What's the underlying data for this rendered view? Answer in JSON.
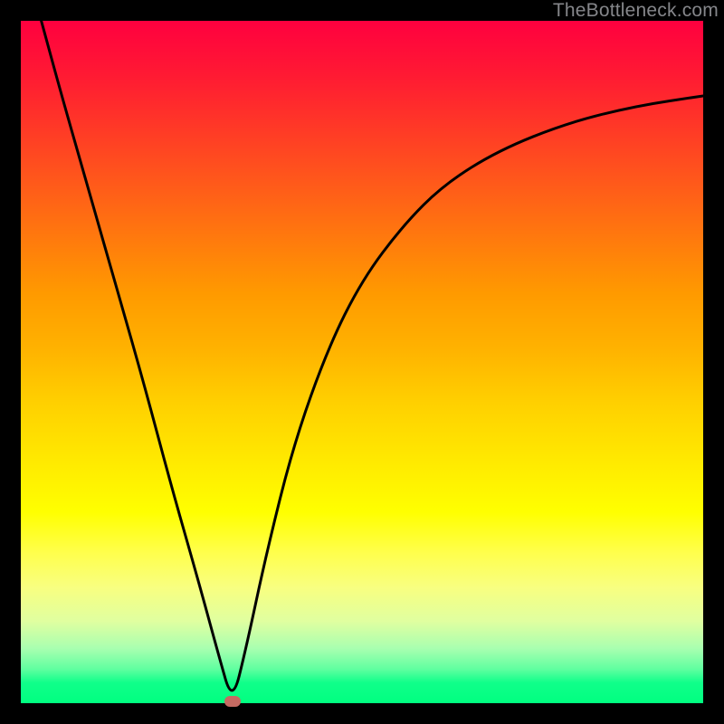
{
  "watermark": "TheBottleneck.com",
  "chart_data": {
    "type": "line",
    "title": "",
    "xlabel": "",
    "ylabel": "",
    "xlim": [
      0,
      100
    ],
    "ylim": [
      0,
      100
    ],
    "grid": false,
    "min_point": {
      "x": 31,
      "y": 0
    },
    "description": "V-shaped curve on rainbow gradient background. Steep linear descent from top-left to minimum near x≈31, then rising concave curve to upper-right. Minimum marked with a small rounded rectangle.",
    "series": [
      {
        "name": "curve",
        "x": [
          3,
          6,
          10,
          14,
          18,
          22,
          26,
          29,
          31,
          33,
          36,
          40,
          45,
          50,
          56,
          62,
          70,
          80,
          90,
          100
        ],
        "y": [
          100,
          89,
          75,
          61,
          47,
          32,
          18,
          7,
          0,
          8,
          22,
          38,
          52,
          62,
          70,
          76,
          81,
          85,
          87.5,
          89
        ]
      }
    ],
    "background_gradient": {
      "type": "vertical",
      "stops": [
        {
          "pos": 0,
          "color": "#ff003f"
        },
        {
          "pos": 40,
          "color": "#ff9a00"
        },
        {
          "pos": 72,
          "color": "#ffff00"
        },
        {
          "pos": 100,
          "color": "#00ff80"
        }
      ]
    }
  }
}
